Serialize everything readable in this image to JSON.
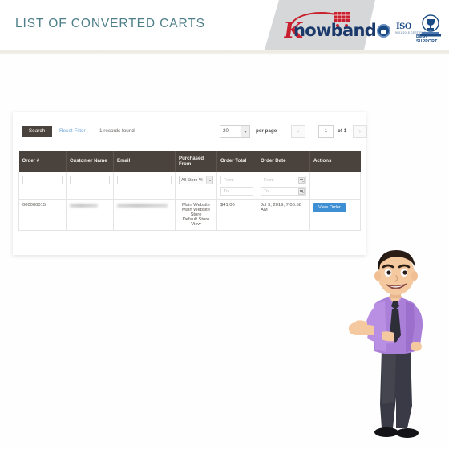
{
  "header": {
    "title": "LIST OF CONVERTED CARTS",
    "logo": {
      "k": "K",
      "word": "nowband",
      "name": "knowband-logo"
    },
    "badges": [
      {
        "name": "secure-seal-badge",
        "label": ""
      },
      {
        "name": "iso-badge",
        "label": "ISO",
        "sub": "9001:2015 CERTIFIED"
      },
      {
        "name": "best-support-badge",
        "label": "BEST SUPPORT"
      }
    ]
  },
  "toolbar": {
    "search_label": "Search",
    "reset_label": "Reset Filter",
    "records_found": "1 records found",
    "per_page_value": "20",
    "per_page_label": "per page",
    "prev_label": "‹",
    "next_label": "›",
    "page_value": "1",
    "of_label": "of 1"
  },
  "table": {
    "columns": [
      "Order #",
      "Customer Name",
      "Email",
      "Purchased From",
      "Order Total",
      "Order Date",
      "Actions"
    ],
    "filters": {
      "order_value": "",
      "customer_value": "",
      "email_value": "",
      "store_value": "All Store Vi",
      "total_from_placeholder": "From",
      "total_to_placeholder": "To",
      "date_from_placeholder": "From",
      "date_to_placeholder": "To"
    },
    "rows": [
      {
        "order": "000000015",
        "customer": "",
        "email": "",
        "purchased_from": "Main Website\nMain Website Store\nDefault Store View",
        "order_total": "$41.00",
        "order_date": "Jul 9, 2019, 7:06:58 AM",
        "action_label": "View Order"
      }
    ]
  },
  "colors": {
    "title": "#4e7f89",
    "table_header": "#4a423c",
    "link": "#6ba4d8",
    "action_button": "#3f8fd4",
    "logo_red": "#c9202f",
    "logo_navy": "#1b3a6b",
    "badge_blue": "#1b4b85",
    "header_grey": "#d6d7d9"
  },
  "mascot": {
    "name": "businessman-mascot",
    "shirt": "#a97fd8",
    "tie": "#2e2e38",
    "pants": "#3a3a46",
    "skin": "#f4c9a0",
    "hair": "#2a1d16",
    "shoes": "#141418"
  }
}
